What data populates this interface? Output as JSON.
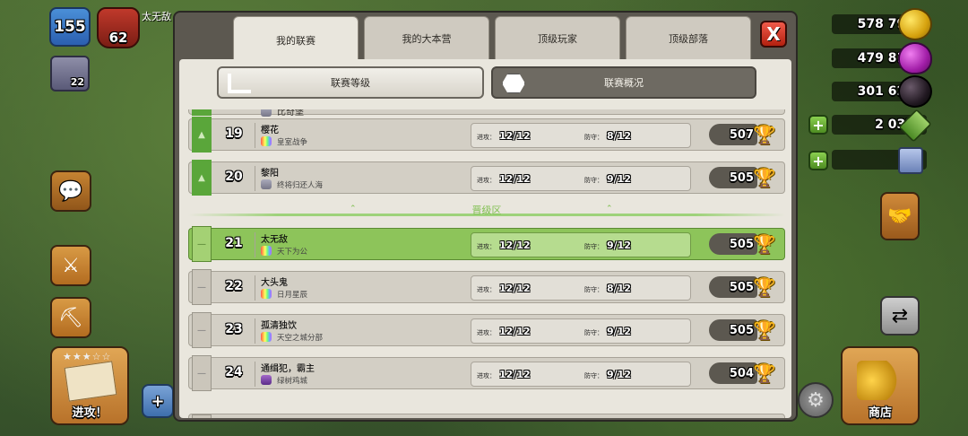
{
  "hud_left": {
    "xp_level": "155",
    "trophy_count": "62",
    "player_name": "太无敌",
    "league_level": "22",
    "raid_label": "进攻！",
    "raid_stars": "★★★☆☆"
  },
  "hud_right": {
    "gold": "578 795",
    "elixir": "479 814",
    "dark_elixir": "301 629",
    "gems": "2 037",
    "tickets": "0",
    "shop_label": "商店",
    "colors": {
      "gold": "#f2c62a",
      "elixir": "#c02fc5",
      "dark_elixir": "#231a23",
      "gem": "#6dbb36"
    }
  },
  "tabs": [
    {
      "label": "我的联赛",
      "active": true
    },
    {
      "label": "我的大本营",
      "active": false
    },
    {
      "label": "顶级玩家",
      "active": false
    },
    {
      "label": "顶级部落",
      "active": false
    }
  ],
  "close_label": "X",
  "sub_tabs": [
    {
      "label": "联赛等级",
      "active": true
    },
    {
      "label": "联赛概况",
      "active": false
    }
  ],
  "partial_top_clan": "比奇堡",
  "promotion_zone_label": "晋级区",
  "stat_labels": {
    "attack": "进攻：",
    "defense": "防守："
  },
  "rows": [
    {
      "rank": "19",
      "player": "樱花",
      "clan": "皇室战争",
      "attack": "12/12",
      "defense": "8/12",
      "trophies": "507",
      "promoted": true,
      "mine": false
    },
    {
      "rank": "20",
      "player": "黎阳",
      "clan": "终将归还人海",
      "attack": "12/12",
      "defense": "9/12",
      "trophies": "505",
      "promoted": true,
      "mine": false
    },
    {
      "rank": "21",
      "player": "太无敌",
      "clan": "天下为公",
      "attack": "12/12",
      "defense": "9/12",
      "trophies": "505",
      "promoted": false,
      "mine": true
    },
    {
      "rank": "22",
      "player": "大头鬼",
      "clan": "日月星辰",
      "attack": "12/12",
      "defense": "8/12",
      "trophies": "505",
      "promoted": false,
      "mine": false
    },
    {
      "rank": "23",
      "player": "孤清独饮",
      "clan": "天空之城分部",
      "attack": "12/12",
      "defense": "9/12",
      "trophies": "505",
      "promoted": false,
      "mine": false
    },
    {
      "rank": "24",
      "player": "通缉犯，霸主",
      "clan": "绿树鸡城",
      "attack": "12/12",
      "defense": "9/12",
      "trophies": "504",
      "promoted": false,
      "mine": false
    }
  ]
}
